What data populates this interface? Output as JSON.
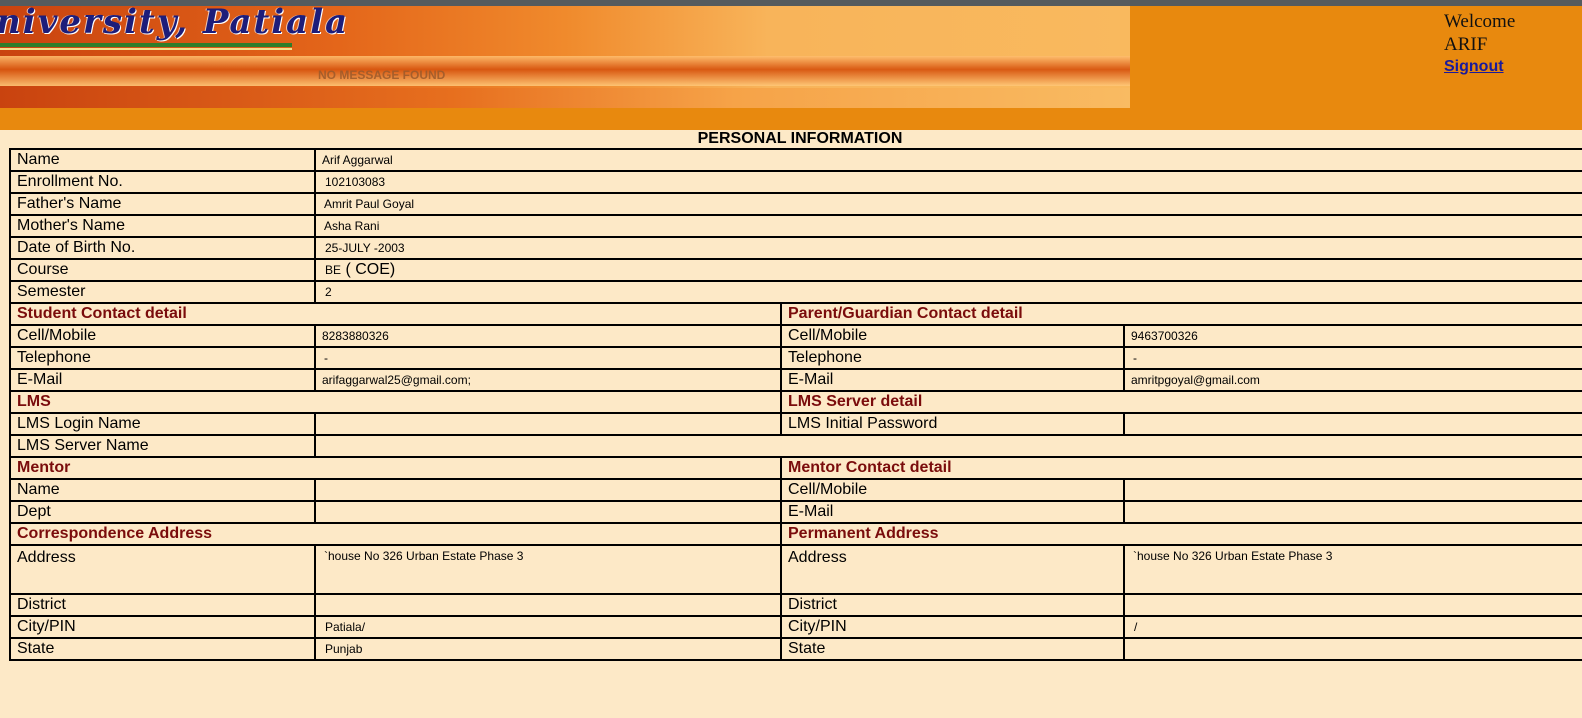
{
  "header": {
    "university_title": "niversity, Patiala",
    "message": "NO MESSAGE FOUND",
    "welcome_text": "Welcome",
    "user_name": "ARIF",
    "signout_label": "Signout"
  },
  "page_title": "PERSONAL INFORMATION",
  "personal": [
    {
      "label": "Name",
      "value": "Arif Aggarwal"
    },
    {
      "label": "Enrollment No.",
      "value": "102103083"
    },
    {
      "label": "Father's Name",
      "value": "Amrit Paul Goyal"
    },
    {
      "label": "Mother's Name",
      "value": "Asha Rani"
    },
    {
      "label": "Date of Birth No.",
      "value": "25-JULY -2003"
    },
    {
      "label": "Course",
      "value_prefix": "BE",
      "value_suffix": " ( COE)"
    },
    {
      "label": "Semester",
      "value": "2"
    }
  ],
  "contact": {
    "student_title": "Student Contact detail",
    "parent_title": "Parent/Guardian Contact detail",
    "rows": [
      {
        "label": "Cell/Mobile",
        "student": "8283880326",
        "parent_label": "Cell/Mobile",
        "parent": "9463700326"
      },
      {
        "label": "Telephone",
        "student": "-",
        "parent_label": "Telephone",
        "parent": "-"
      },
      {
        "label": "E-Mail",
        "student": "arifaggarwal25@gmail.com;",
        "parent_label": "E-Mail",
        "parent": "amritpgoyal@gmail.com"
      }
    ]
  },
  "lms": {
    "title": "LMS",
    "server_title": "LMS Server detail",
    "login_label": "LMS Login Name",
    "login_value": "",
    "password_label": "LMS Initial Password",
    "password_value": "",
    "server_label": "LMS Server Name",
    "server_value": ""
  },
  "mentor": {
    "title": "Mentor",
    "contact_title": "Mentor Contact detail",
    "name_label": "Name",
    "name_value": "",
    "dept_label": "Dept",
    "dept_value": "",
    "cell_label": "Cell/Mobile",
    "cell_value": "",
    "email_label": "E-Mail",
    "email_value": ""
  },
  "address": {
    "corr_title": "Correspondence Address",
    "perm_title": "Permanent Address",
    "rows": [
      {
        "label": "Address",
        "corr": "`house No 326 Urban Estate Phase 3",
        "perm_label": "Address",
        "perm": "`house No 326 Urban Estate Phase 3"
      },
      {
        "label": "District",
        "corr": "",
        "perm_label": "District",
        "perm": ""
      },
      {
        "label": "City/PIN",
        "corr": "Patiala/",
        "perm_label": "City/PIN",
        "perm": "/"
      },
      {
        "label": "State",
        "corr": "Punjab",
        "perm_label": "State",
        "perm": ""
      }
    ]
  }
}
